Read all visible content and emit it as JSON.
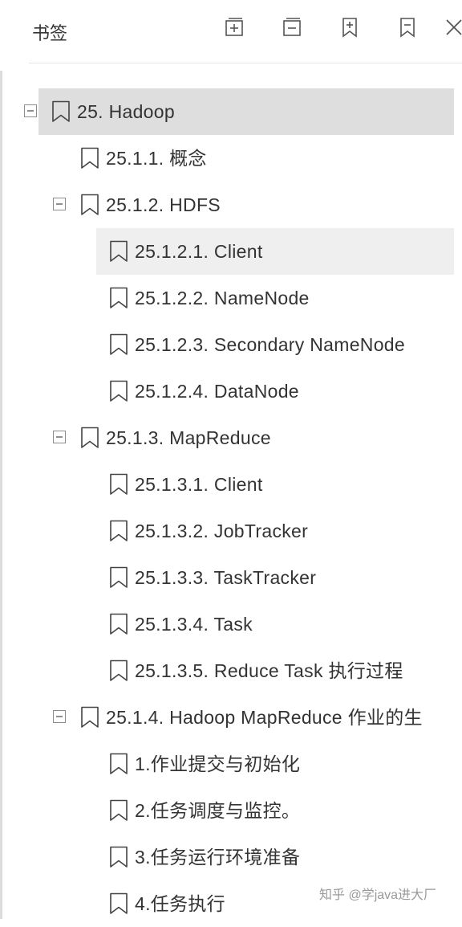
{
  "panel": {
    "title": "书签",
    "toolbar": [
      {
        "name": "expand-all-button",
        "icon": "expand-all-icon",
        "tooltip": ""
      },
      {
        "name": "collapse-all-button",
        "icon": "collapse-all-icon",
        "tooltip": ""
      },
      {
        "name": "add-bookmark-button",
        "icon": "add-bookmark-icon",
        "tooltip": ""
      },
      {
        "name": "remove-bookmark-button",
        "icon": "remove-bookmark-icon",
        "tooltip": ""
      },
      {
        "name": "close-button",
        "icon": "close-icon",
        "tooltip": ""
      }
    ]
  },
  "bookmarks": [
    {
      "label": "25. Hadoop",
      "level": 0,
      "collapsible": true,
      "state": "selected"
    },
    {
      "label": "25.1.1. 概念",
      "level": 1,
      "collapsible": false
    },
    {
      "label": "25.1.2. HDFS",
      "level": 1,
      "collapsible": true
    },
    {
      "label": "25.1.2.1.  Client",
      "level": 2,
      "collapsible": false,
      "state": "hover"
    },
    {
      "label": "25.1.2.2.  NameNode",
      "level": 2,
      "collapsible": false
    },
    {
      "label": "25.1.2.3. Secondary NameNode",
      "level": 2,
      "collapsible": false
    },
    {
      "label": "25.1.2.4. DataNode",
      "level": 2,
      "collapsible": false
    },
    {
      "label": "25.1.3. MapReduce",
      "level": 1,
      "collapsible": true
    },
    {
      "label": "25.1.3.1.  Client",
      "level": 2,
      "collapsible": false
    },
    {
      "label": "25.1.3.2.  JobTracker",
      "level": 2,
      "collapsible": false
    },
    {
      "label": "25.1.3.3. TaskTracker",
      "level": 2,
      "collapsible": false
    },
    {
      "label": "25.1.3.4.  Task",
      "level": 2,
      "collapsible": false
    },
    {
      "label": "25.1.3.5. Reduce Task 执行过程",
      "level": 2,
      "collapsible": false
    },
    {
      "label": "25.1.4. Hadoop MapReduce 作业的生",
      "level": 1,
      "collapsible": true
    },
    {
      "label": "1.作业提交与初始化",
      "level": 2,
      "collapsible": false
    },
    {
      "label": "2.任务调度与监控。",
      "level": 2,
      "collapsible": false
    },
    {
      "label": "3.任务运行环境准备",
      "level": 2,
      "collapsible": false
    },
    {
      "label": "4.任务执行",
      "level": 2,
      "collapsible": false
    }
  ],
  "watermark": "知乎 @学java进大厂",
  "colors": {
    "selected_bg": "#dedede",
    "hover_bg": "#efefef",
    "text": "#333333",
    "icon": "#555555"
  }
}
